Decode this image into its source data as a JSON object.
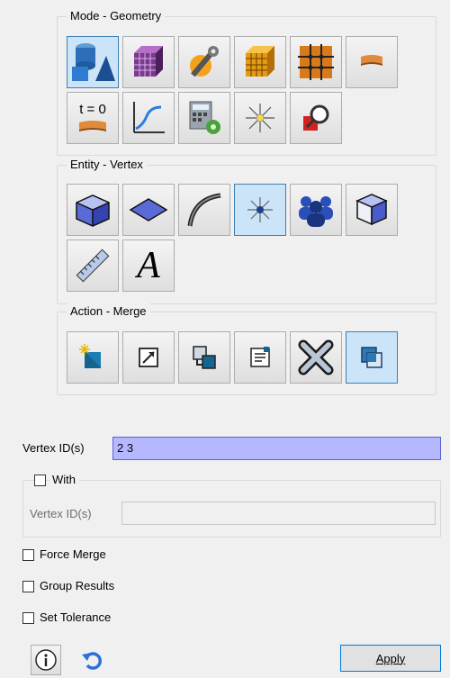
{
  "groups": {
    "mode": {
      "title": "Mode - Geometry"
    },
    "entity": {
      "title": "Entity - Vertex"
    },
    "action": {
      "title": "Action - Merge"
    }
  },
  "mode_tools": [
    {
      "icon": "geometry-primitives-icon"
    },
    {
      "icon": "mesh-cube-icon"
    },
    {
      "icon": "tools-wrench-icon"
    },
    {
      "icon": "hex-mesh-cube-icon"
    },
    {
      "icon": "grid-mesh-icon"
    },
    {
      "icon": "boundary-condition-icon"
    },
    {
      "icon": "time-zero-icon",
      "text": "t = 0"
    },
    {
      "icon": "plot-graph-icon"
    },
    {
      "icon": "calculator-settings-icon"
    },
    {
      "icon": "sparkle-icon"
    },
    {
      "icon": "zoom-inspect-icon"
    }
  ],
  "entity_tools": [
    {
      "icon": "volume-icon"
    },
    {
      "icon": "surface-icon"
    },
    {
      "icon": "curve-icon"
    },
    {
      "icon": "vertex-icon",
      "selected": true
    },
    {
      "icon": "group-people-icon"
    },
    {
      "icon": "body-icon"
    },
    {
      "icon": "measure-ruler-icon"
    },
    {
      "icon": "text-annotation-icon",
      "text": "A"
    }
  ],
  "action_tools": [
    {
      "icon": "create-vertex-icon"
    },
    {
      "icon": "modify-icon"
    },
    {
      "icon": "move-copy-icon"
    },
    {
      "icon": "properties-icon"
    },
    {
      "icon": "delete-icon"
    },
    {
      "icon": "merge-icon",
      "selected": true
    }
  ],
  "form": {
    "vertex_ids_label": "Vertex ID(s)",
    "vertex_ids_value": "2 3",
    "with_label": "With",
    "with_vertex_ids_label": "Vertex ID(s)",
    "with_vertex_ids_value": "",
    "force_merge_label": "Force Merge",
    "group_results_label": "Group Results",
    "set_tolerance_label": "Set Tolerance",
    "apply_label": "Apply"
  },
  "colors": {
    "selected_bg": "#cce4f7",
    "input_highlight": "#b6b8ff"
  }
}
